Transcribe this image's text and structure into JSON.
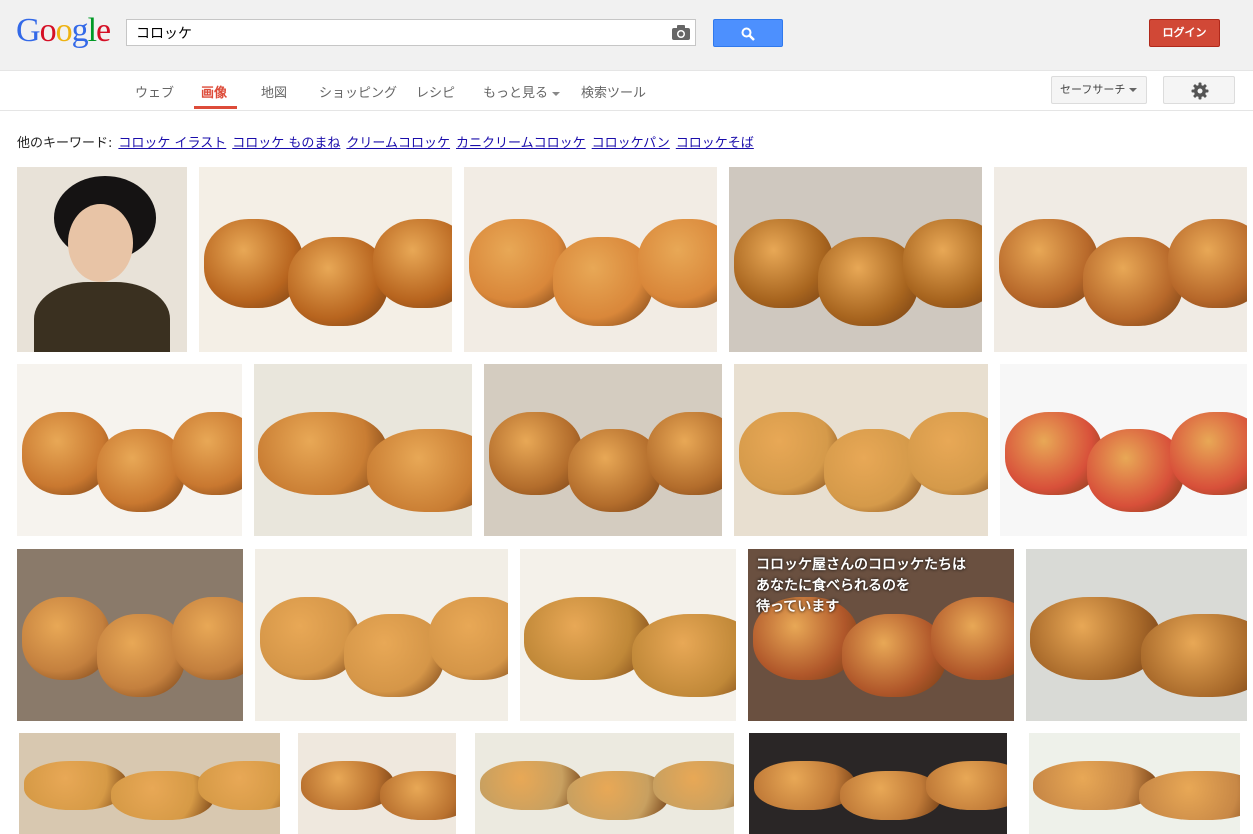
{
  "logo": {
    "letters": [
      "G",
      "o",
      "o",
      "g",
      "l",
      "e"
    ],
    "colors": [
      "#3369e8",
      "#d50f25",
      "#eeb211",
      "#3369e8",
      "#009925",
      "#d50f25"
    ]
  },
  "search": {
    "value": "コロッケ",
    "placeholder": ""
  },
  "header": {
    "login_label": "ログイン"
  },
  "nav": {
    "tabs": [
      {
        "label": "ウェブ"
      },
      {
        "label": "画像"
      },
      {
        "label": "地図"
      },
      {
        "label": "ショッピング"
      },
      {
        "label": "レシピ"
      },
      {
        "label": "もっと見る"
      },
      {
        "label": "検索ツール"
      }
    ],
    "safesearch_label": "セーフサーチ"
  },
  "related": {
    "prefix": "他のキーワード:",
    "links": [
      "コロッケ イラスト",
      "コロッケ ものまね",
      "クリームコロッケ",
      "カニクリームコロッケ",
      "コロッケパン",
      "コロッケそば"
    ]
  },
  "results": {
    "caption_image": "コロッケ屋さんのコロッケたちは\nあなたに食べられるのを\n待っています"
  },
  "colors": {
    "accent": "#dd4b39",
    "link": "#1a0dab",
    "search_blue": "#4d90fe",
    "login_red": "#d14836"
  }
}
